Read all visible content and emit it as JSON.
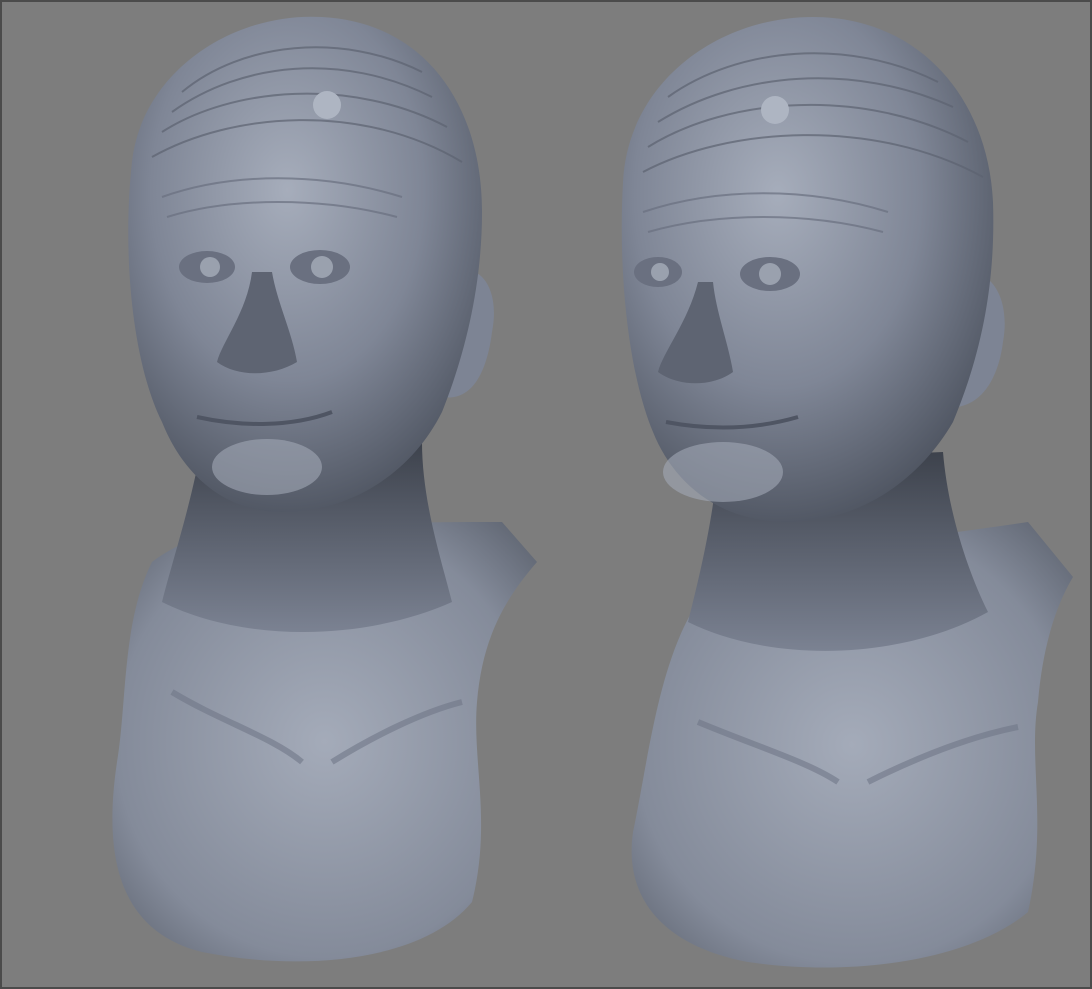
{
  "viewport": {
    "background_color": "#7d7d7d",
    "border_color": "#4b4b4b"
  },
  "renders": [
    {
      "label": "",
      "subject": "sculpt-bust",
      "view": "three-quarter",
      "material_color": "#8a91a0"
    },
    {
      "label": "",
      "subject": "sculpt-bust",
      "view": "three-quarter-turned",
      "material_color": "#8a91a0"
    }
  ]
}
